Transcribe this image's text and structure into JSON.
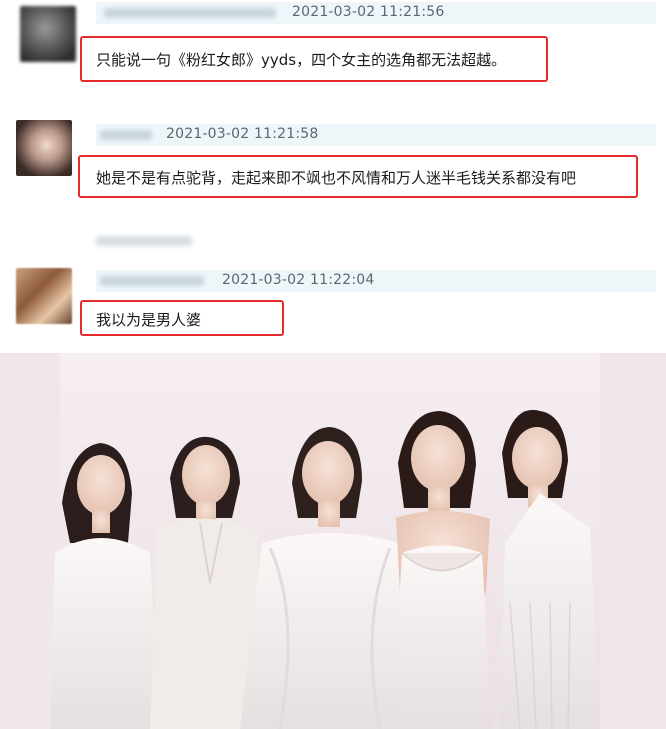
{
  "comments": [
    {
      "timestamp": "2021-03-02 11:21:56",
      "text": "只能说一句《粉红女郎》yyds，四个女主的选角都无法超越。"
    },
    {
      "timestamp": "2021-03-02 11:21:58",
      "text": "她是不是有点驼背，走起来即不飒也不风情和万人迷半毛钱关系都没有吧"
    },
    {
      "timestamp": "2021-03-02 11:22:04",
      "text": "我以为是男人婆"
    }
  ],
  "colors": {
    "highlight_border": "#e52b2b",
    "header_bg": "#eef6fa",
    "timestamp": "#5c6670",
    "backdrop": "#f2e9ec"
  }
}
